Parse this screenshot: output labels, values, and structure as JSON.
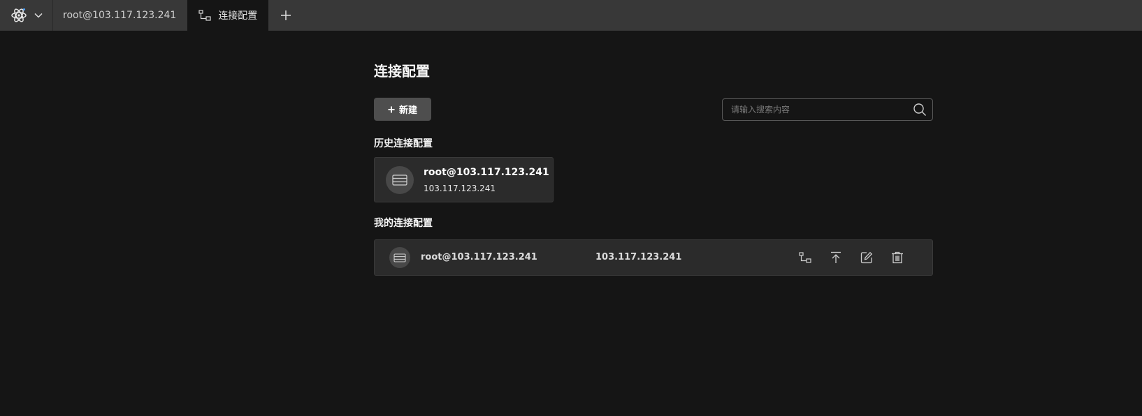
{
  "tabbar": {
    "tabs": [
      {
        "label": "root@103.117.123.241",
        "active": false
      },
      {
        "label": "连接配置",
        "active": true
      }
    ]
  },
  "page": {
    "title": "连接配置",
    "new_button_label": "新建",
    "search_placeholder": "请输入搜索内容"
  },
  "history": {
    "title": "历史连接配置",
    "items": [
      {
        "name": "root@103.117.123.241",
        "host": "103.117.123.241"
      }
    ]
  },
  "mine": {
    "title": "我的连接配置",
    "items": [
      {
        "name": "root@103.117.123.241",
        "host": "103.117.123.241"
      }
    ]
  },
  "icons": {
    "app": "atom-icon",
    "menu": "chevron-down-icon",
    "tab_connection": "network-icon",
    "add_tab": "plus-icon",
    "search": "search-icon",
    "server": "server-icon",
    "connect": "network-icon",
    "upload": "upload-icon",
    "edit": "edit-icon",
    "delete": "trash-icon"
  },
  "colors": {
    "background": "#151515",
    "tabbar": "#383838",
    "card": "#2b2b2b",
    "button": "#4e4e4e"
  }
}
